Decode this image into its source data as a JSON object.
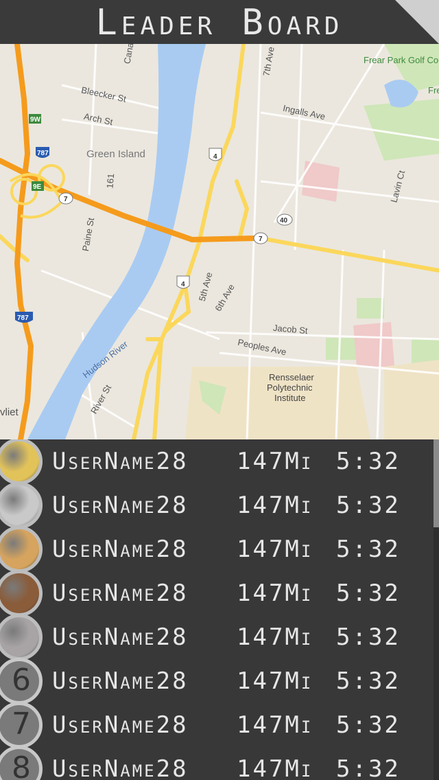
{
  "header": {
    "title": "Leader Board"
  },
  "map": {
    "labels": {
      "bleecker": "Bleecker St",
      "arch": "Arch St",
      "green_island": "Green Island",
      "canal": "Cana",
      "seventh": "7th Ave",
      "ingalls": "Ingalls Ave",
      "frear": "Frear Park Golf Cou",
      "fre": "Fre",
      "lavin": "Lavin Ct",
      "paine": "Paine St",
      "fifth": "5th Ave",
      "sixth": "6th Ave",
      "jacob": "Jacob St",
      "peoples": "Peoples Ave",
      "hudson": "Hudson River",
      "rpi1": "Rensselaer",
      "rpi2": "Polytechnic",
      "rpi3": "Institute",
      "river": "River St",
      "vliet": "vliet",
      "s161": "161"
    },
    "shields": {
      "r9w": "9W",
      "i787a": "787",
      "r9e": "9E",
      "r7a": "7",
      "r4a": "4",
      "r40": "40",
      "r7b": "7",
      "r4b": "4",
      "i787b": "787"
    }
  },
  "leaderboard": {
    "rows": [
      {
        "rank": "1",
        "name": "UserName28",
        "distance": "147Mi",
        "time": "5:32"
      },
      {
        "rank": "2",
        "name": "UserName28",
        "distance": "147Mi",
        "time": "5:32"
      },
      {
        "rank": "3",
        "name": "UserName28",
        "distance": "147Mi",
        "time": "5:32"
      },
      {
        "rank": "4",
        "name": "UserName28",
        "distance": "147Mi",
        "time": "5:32"
      },
      {
        "rank": "5",
        "name": "UserName28",
        "distance": "147Mi",
        "time": "5:32"
      },
      {
        "rank": "6",
        "name": "UserName28",
        "distance": "147Mi",
        "time": "5:32"
      },
      {
        "rank": "7",
        "name": "UserName28",
        "distance": "147Mi",
        "time": "5:32"
      },
      {
        "rank": "8",
        "name": "UserName28",
        "distance": "147Mi",
        "time": "5:32"
      }
    ],
    "medal_colors": [
      "#e2c35a",
      "#c9c9c9",
      "#d6a45e",
      "#8a5c3a",
      "#a8a4a6"
    ]
  },
  "colors": {
    "water": "#a9cbf2",
    "highway": "#f59b1c",
    "road": "#fbd75b",
    "park": "#cfe6b8"
  }
}
